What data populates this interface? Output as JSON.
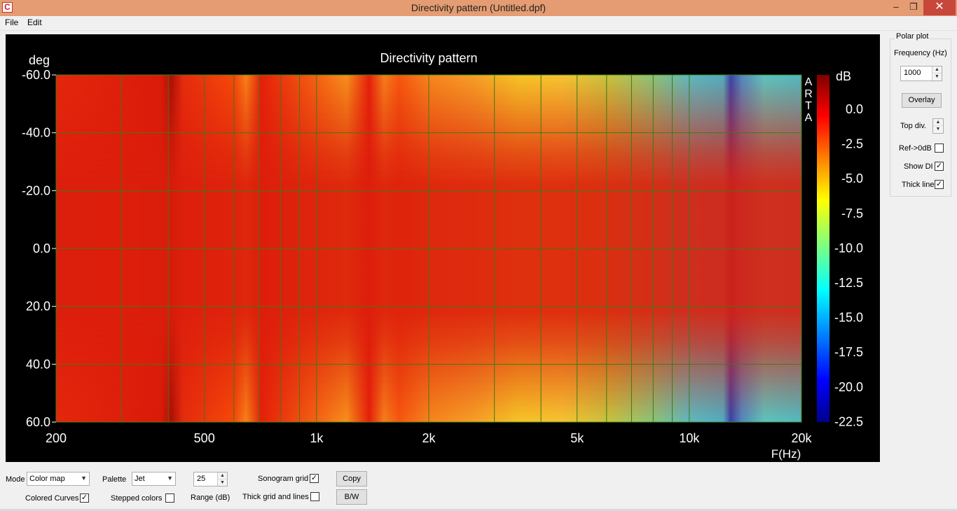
{
  "window": {
    "title": "Directivity pattern (Untitled.dpf)",
    "minimize": "–",
    "maximize": "❐",
    "close": "✕"
  },
  "menu": {
    "file": "File",
    "edit": "Edit"
  },
  "plot": {
    "title": "Directivity pattern",
    "y_unit_label": "deg",
    "x_unit_label": "F(Hz)",
    "y_ticks": [
      "-60.0",
      "-40.0",
      "-20.0",
      "0.0",
      "20.0",
      "40.0",
      "60.0"
    ],
    "x_ticks": [
      "200",
      "500",
      "1k",
      "2k",
      "5k",
      "10k",
      "20k"
    ],
    "watermark": [
      "A",
      "R",
      "T",
      "A"
    ],
    "colorbar_unit": "dB",
    "colorbar_ticks": [
      "0.0",
      "-2.5",
      "-5.0",
      "-7.5",
      "-10.0",
      "-12.5",
      "-15.0",
      "-17.5",
      "-20.0",
      "-22.5"
    ],
    "colors": {
      "dark_red": "#8b0000",
      "red": "#e8200d",
      "orange": "#ff8c00",
      "yellow": "#ffff2a",
      "cyan": "#20ffff",
      "blue": "#0030e0",
      "grid": "#3c7a1a"
    }
  },
  "polar_plot": {
    "group_label": "Polar plot",
    "frequency_label": "Frequency (Hz)",
    "frequency_value": "1000",
    "overlay_button": "Overlay",
    "top_div_label": "Top div.",
    "ref_0db_label": "Ref->0dB",
    "ref_0db_checked": false,
    "show_di_label": "Show DI",
    "show_di_checked": true,
    "thick_line_label": "Thick line",
    "thick_line_checked": true
  },
  "bottom_controls": {
    "mode_label": "Mode",
    "mode_value": "Color map",
    "palette_label": "Palette",
    "palette_value": "Jet",
    "range_value": "25",
    "range_label": "Range (dB)",
    "sonogram_grid_label": "Sonogram grid",
    "sonogram_grid_checked": true,
    "colored_curves_label": "Colored Curves",
    "colored_curves_checked": true,
    "stepped_colors_label": "Stepped colors",
    "stepped_colors_checked": false,
    "thick_grid_label": "Thick grid and  lines",
    "thick_grid_checked": false,
    "copy_button": "Copy",
    "bw_button": "B/W"
  }
}
